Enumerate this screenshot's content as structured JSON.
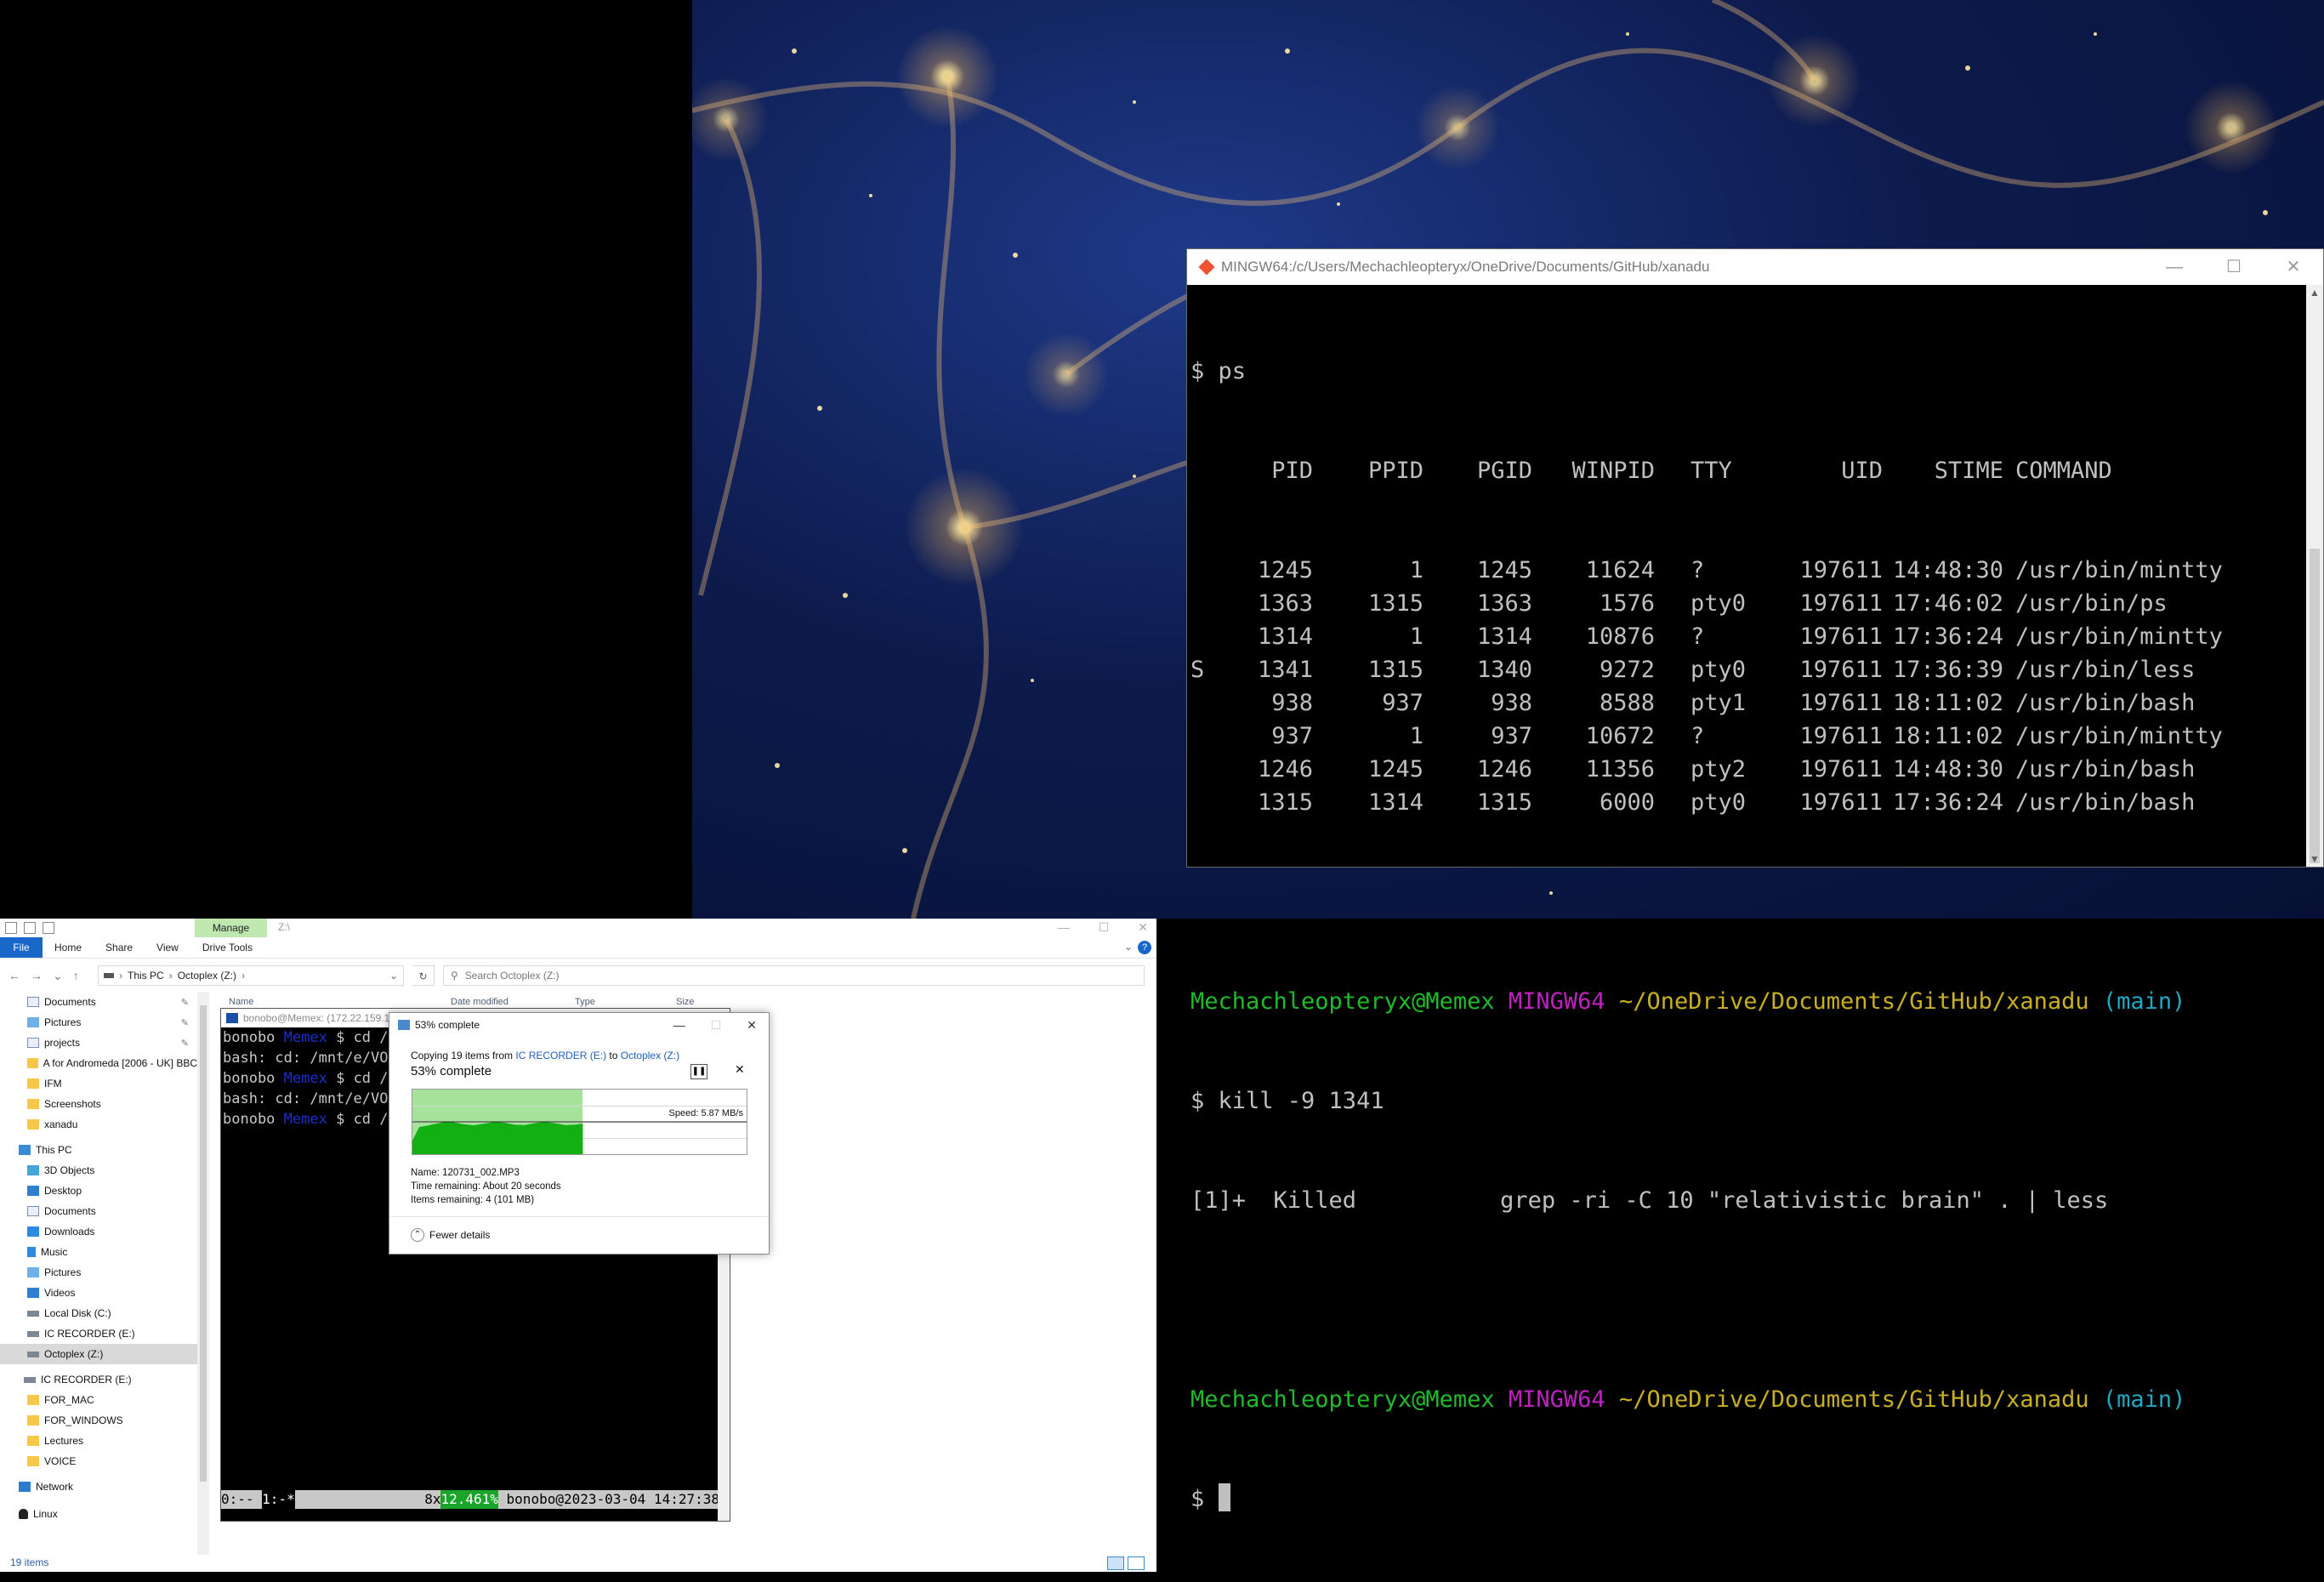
{
  "mintty": {
    "title": "MINGW64:/c/Users/Mechachleopteryx/OneDrive/Documents/GitHub/xanadu",
    "minimize": "—",
    "maximize": "☐",
    "close": "✕",
    "cmd1": "$ ps",
    "ps_header": {
      "pid": "PID",
      "ppid": "PPID",
      "pgid": "PGID",
      "winpid": "WINPID",
      "tty": "TTY",
      "uid": "UID",
      "stime": "STIME",
      "command": "COMMAND"
    },
    "ps_rows": [
      {
        "s": "",
        "pid": "1245",
        "ppid": "1",
        "pgid": "1245",
        "winpid": "11624",
        "tty": "?",
        "uid": "197611",
        "stime": "14:48:30",
        "command": "/usr/bin/mintty"
      },
      {
        "s": "",
        "pid": "1363",
        "ppid": "1315",
        "pgid": "1363",
        "winpid": "1576",
        "tty": "pty0",
        "uid": "197611",
        "stime": "17:46:02",
        "command": "/usr/bin/ps"
      },
      {
        "s": "",
        "pid": "1314",
        "ppid": "1",
        "pgid": "1314",
        "winpid": "10876",
        "tty": "?",
        "uid": "197611",
        "stime": "17:36:24",
        "command": "/usr/bin/mintty"
      },
      {
        "s": "S",
        "pid": "1341",
        "ppid": "1315",
        "pgid": "1340",
        "winpid": "9272",
        "tty": "pty0",
        "uid": "197611",
        "stime": "17:36:39",
        "command": "/usr/bin/less"
      },
      {
        "s": "",
        "pid": "938",
        "ppid": "937",
        "pgid": "938",
        "winpid": "8588",
        "tty": "pty1",
        "uid": "197611",
        "stime": "18:11:02",
        "command": "/usr/bin/bash"
      },
      {
        "s": "",
        "pid": "937",
        "ppid": "1",
        "pgid": "937",
        "winpid": "10672",
        "tty": "?",
        "uid": "197611",
        "stime": "18:11:02",
        "command": "/usr/bin/mintty"
      },
      {
        "s": "",
        "pid": "1246",
        "ppid": "1245",
        "pgid": "1246",
        "winpid": "11356",
        "tty": "pty2",
        "uid": "197611",
        "stime": "14:48:30",
        "command": "/usr/bin/bash"
      },
      {
        "s": "",
        "pid": "1315",
        "ppid": "1314",
        "pgid": "1315",
        "winpid": "6000",
        "tty": "pty0",
        "uid": "197611",
        "stime": "17:36:24",
        "command": "/usr/bin/bash"
      }
    ],
    "prompt_user": "Mechachleopteryx@Memex",
    "prompt_env": "MINGW64",
    "prompt_path": "~/OneDrive/Documents/GitHub/xanadu",
    "prompt_branch": "(main)",
    "cmd2": "$ kill -9 1341",
    "killed_job": "[1]+  Killed",
    "killed_cmd": "grep -ri -C 10 \"relativistic brain\" . | less",
    "last_prompt": "$ "
  },
  "explorer": {
    "manage_tab": "Manage",
    "path_title": "Z:\\",
    "tabs": {
      "file": "File",
      "home": "Home",
      "share": "Share",
      "view": "View",
      "drive_tools": "Drive Tools"
    },
    "help": "?",
    "breadcrumb": [
      "This PC",
      "Octoplex (Z:)"
    ],
    "search_placeholder": "Search Octoplex (Z:)",
    "columns": {
      "name": "Name",
      "date": "Date modified",
      "type": "Type",
      "size": "Size"
    },
    "nav": {
      "quick": [
        {
          "label": "Documents",
          "icon": "documents-icon",
          "pin": true
        },
        {
          "label": "Pictures",
          "icon": "pictures-icon",
          "pin": true
        },
        {
          "label": "projects",
          "icon": "projects-icon",
          "pin": true
        },
        {
          "label": "A for Andromeda [2006 - UK] BBC",
          "icon": "folder-icon",
          "pin": false
        },
        {
          "label": "IFM",
          "icon": "folder-icon",
          "pin": false
        },
        {
          "label": "Screenshots",
          "icon": "folder-icon",
          "pin": false
        },
        {
          "label": "xanadu",
          "icon": "folder-icon",
          "pin": false
        }
      ],
      "this_pc": "This PC",
      "pc_items": [
        {
          "label": "3D Objects",
          "icon": "3d-objects-icon"
        },
        {
          "label": "Desktop",
          "icon": "desktop-icon"
        },
        {
          "label": "Documents",
          "icon": "documents-icon"
        },
        {
          "label": "Downloads",
          "icon": "downloads-icon"
        },
        {
          "label": "Music",
          "icon": "music-icon"
        },
        {
          "label": "Pictures",
          "icon": "pictures-icon"
        },
        {
          "label": "Videos",
          "icon": "videos-icon"
        },
        {
          "label": "Local Disk (C:)",
          "icon": "drive-icon"
        },
        {
          "label": "IC RECORDER (E:)",
          "icon": "drive-icon"
        },
        {
          "label": "Octoplex (Z:)",
          "icon": "drive-icon"
        }
      ],
      "ic_recorder": "IC RECORDER (E:)",
      "ic_folders": [
        "FOR_MAC",
        "FOR_WINDOWS",
        "Lectures",
        "VOICE"
      ],
      "network": "Network",
      "linux": "Linux"
    },
    "status": "19 items"
  },
  "ssh": {
    "title": "bonobo@Memex: (172.22.159.1",
    "lines": [
      {
        "user": "bonobo",
        "host": "Memex",
        "rest": " $ cd /"
      },
      {
        "text": "bash: cd: /mnt/e/VO"
      },
      {
        "user": "bonobo",
        "host": "Memex",
        "rest": " $ cd /"
      },
      {
        "text": "bash: cd: /mnt/e/VO"
      },
      {
        "user": "bonobo",
        "host": "Memex",
        "rest": " $ cd /"
      }
    ],
    "tmux_win0": "0:-- ",
    "tmux_win1": "1:-*",
    "tmux_cpu": "8x",
    "tmux_pct": "12.461%",
    "tmux_status": " bonobo@2023-03-04 14:27:38"
  },
  "copy_dialog": {
    "title": "53% complete",
    "from_prefix": "Copying 19 items from ",
    "source": "IC RECORDER (E:)",
    "to_word": " to ",
    "dest": "Octoplex (Z:)",
    "heading": "53% complete",
    "progress": 0.53,
    "speed": "Speed: 5.87 MB/s",
    "name": "Name:  120731_002.MP3",
    "time_remaining": "Time remaining:  About 20 seconds",
    "items_remaining": "Items remaining:  4 (101 MB)",
    "fewer_details": "Fewer details",
    "colors": {
      "fill": "#12b012",
      "fill_light": "#a6e39a"
    }
  }
}
